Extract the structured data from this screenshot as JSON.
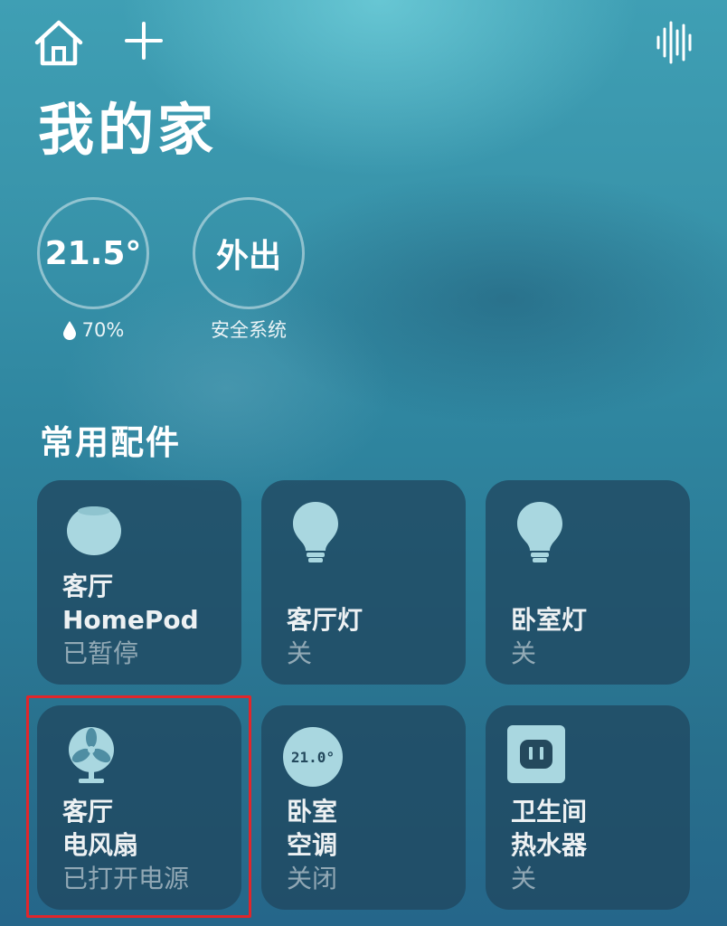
{
  "topbar": {
    "home_icon": "home-icon",
    "add_icon": "plus-icon",
    "voice_icon": "waveform-icon"
  },
  "page": {
    "title": "我的家"
  },
  "status": {
    "temperature": "21.5°",
    "humidity": "70%",
    "security_value": "外出",
    "security_label": "安全系统"
  },
  "section": {
    "title": "常用配件"
  },
  "accessories": [
    {
      "room": "客厅",
      "name": "HomePod",
      "state": "已暂停",
      "icon": "homepod-icon"
    },
    {
      "room": "",
      "name": "客厅灯",
      "state": "关",
      "icon": "lightbulb-icon"
    },
    {
      "room": "",
      "name": "卧室灯",
      "state": "关",
      "icon": "lightbulb-icon"
    },
    {
      "room": "客厅",
      "name": "电风扇",
      "state": "已打开电源",
      "icon": "fan-icon"
    },
    {
      "room": "卧室",
      "name": "空调",
      "state": "关闭",
      "icon": "thermostat-icon",
      "badge": "21.0°"
    },
    {
      "room": "卫生间",
      "name": "热水器",
      "state": "关",
      "icon": "outlet-icon"
    }
  ],
  "colors": {
    "highlight": "#e0262b",
    "tile_bg": "#204860",
    "icon_fill": "#a9d7e0"
  }
}
